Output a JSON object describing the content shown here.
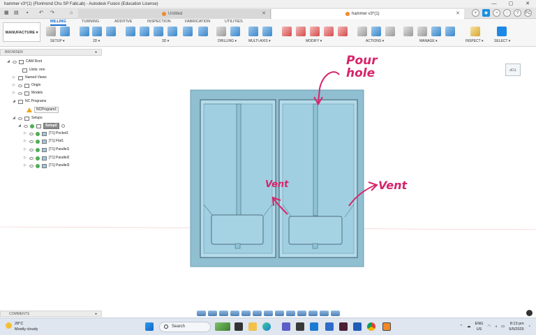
{
  "window": {
    "title": "hammer v3*(1) (Florimond Chu SP FabLab) - Autodesk Fusion (Education License)",
    "min": "—",
    "max": "▢",
    "close": "✕"
  },
  "tabs": [
    {
      "label": "Untitled",
      "close": "✕"
    },
    {
      "label": "hammer v3*(1)",
      "close": "✕"
    }
  ],
  "account": {
    "initials": "FC"
  },
  "ribbon": {
    "workspace": "MANUFACTURE",
    "workspace_arrow": "▾",
    "tabs": [
      "MILLING",
      "TURNING",
      "ADDITIVE",
      "INSPECTION",
      "FABRICATION",
      "UTILITIES"
    ],
    "groups": [
      "SETUP ▾",
      "2D ▾",
      "3D ▾",
      "DRILLING ▾",
      "MULTI-AXIS ▾",
      "MODIFY ▾",
      "ACTIONS ▾",
      "MANAGE ▾",
      "INSPECT ▾",
      "SELECT ▾"
    ]
  },
  "browser": {
    "header": "BROWSER",
    "pin": "●",
    "items": [
      {
        "label": "CAM Root"
      },
      {
        "label": "Units: mm"
      },
      {
        "label": "Named Views"
      },
      {
        "label": "Origin"
      },
      {
        "label": "Models"
      },
      {
        "label": "NC Programs"
      },
      {
        "label": "NCProgram1"
      },
      {
        "label": "Setups"
      },
      {
        "label": "Setup2"
      },
      {
        "label": "[T1] Pocket1"
      },
      {
        "label": "[T1] Flat1"
      },
      {
        "label": "[T1] Parallel1"
      },
      {
        "label": "[T1] Parallel2"
      },
      {
        "label": "[T1] Parallel3"
      }
    ]
  },
  "viewcube": {
    "face": "TOP"
  },
  "annotations": {
    "pour_line1": "Pour",
    "pour_line2": "hole",
    "vent_left": "Vent",
    "vent_right": "Vent"
  },
  "comments": {
    "label": "COMMENTS",
    "pin": "●"
  },
  "taskbar": {
    "temp": "28°C",
    "weather": "Mostly cloudy",
    "search_placeholder": "Search",
    "lang1": "ENG",
    "lang2": "US",
    "time": "8:13 pm",
    "date": "5/5/2025"
  }
}
